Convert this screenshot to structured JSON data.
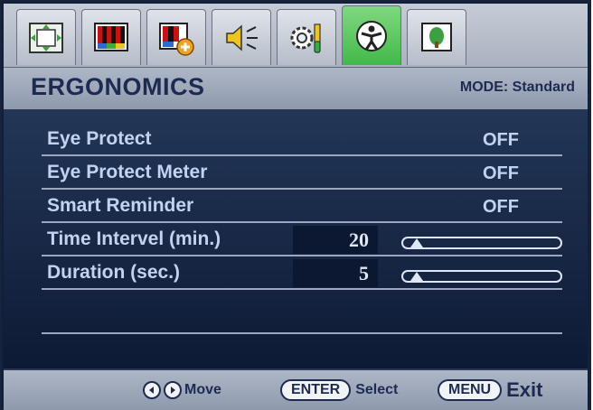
{
  "tabs": [
    {
      "icon": "display-position-icon",
      "active": false
    },
    {
      "icon": "color-bars-icon",
      "active": false
    },
    {
      "icon": "color-adjust-icon",
      "active": false
    },
    {
      "icon": "speaker-icon",
      "active": false
    },
    {
      "icon": "system-settings-icon",
      "active": false
    },
    {
      "icon": "ergonomics-icon",
      "active": true
    },
    {
      "icon": "picture-icon",
      "active": false
    }
  ],
  "header": {
    "title": "ERGONOMICS",
    "mode": "MODE: Standard"
  },
  "rows": [
    {
      "label": "Eye Protect",
      "value": "OFF"
    },
    {
      "label": "Eye Protect Meter",
      "value": "OFF"
    },
    {
      "label": "Smart Reminder",
      "value": "OFF"
    },
    {
      "label": "Time Intervel (min.)",
      "value": "20",
      "slider_level": 0
    },
    {
      "label": "Duration (sec.)",
      "value": "5",
      "slider_level": 0
    }
  ],
  "footer": {
    "move": "Move",
    "enter": "ENTER",
    "select": "Select",
    "menu": "MENU",
    "exit": "Exit"
  },
  "colors": {
    "accent_tab": "#43b84a",
    "menu_bg": "#0f1f3f",
    "text": "#c2d3ef",
    "header_text": "#1d2b52"
  }
}
